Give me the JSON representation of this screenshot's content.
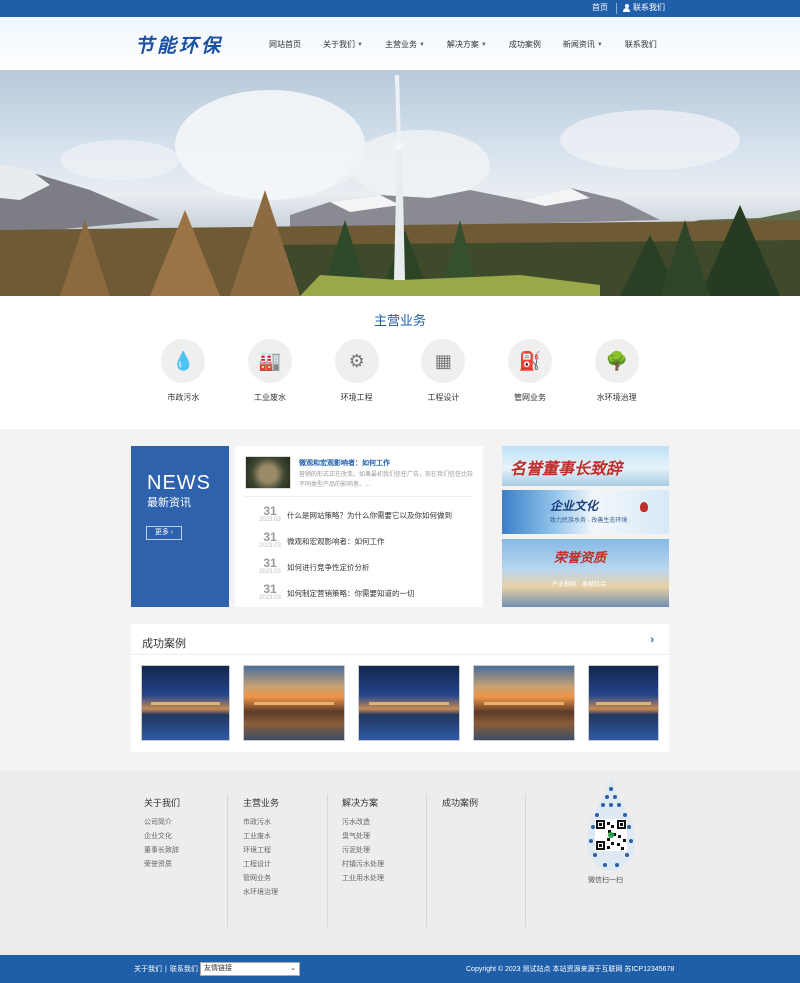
{
  "topbar": {
    "home": "首页",
    "contact": "联系我们"
  },
  "header": {
    "logo": "节能环保",
    "nav": [
      {
        "label": "网站首页"
      },
      {
        "label": "关于我们"
      },
      {
        "label": "主营业务"
      },
      {
        "label": "解决方案"
      },
      {
        "label": "成功案例"
      },
      {
        "label": "新闻资讯"
      },
      {
        "label": "联系我们"
      }
    ]
  },
  "services": {
    "title": "主营业务",
    "items": [
      {
        "label": "市政污水",
        "icon": "water-drop-icon"
      },
      {
        "label": "工业废水",
        "icon": "factory-icon"
      },
      {
        "label": "环境工程",
        "icon": "gear-icon"
      },
      {
        "label": "工程设计",
        "icon": "chart-icon"
      },
      {
        "label": "管网业务",
        "icon": "pipe-icon"
      },
      {
        "label": "水环境治理",
        "icon": "tree-icon"
      }
    ]
  },
  "news": {
    "en": "NEWS",
    "cn": "最新资讯",
    "more": "更多 ›",
    "featured": {
      "title": "微观和宏观影响者：如何工作",
      "desc": "营销的形式正在改变。如果最初我们信任广告，现在我们信任比较不同类型产品的影响者。..."
    },
    "items": [
      {
        "day": "31",
        "ym": "2023.03",
        "text": "什么是网站策略？为什么你需要它以及你如何做到"
      },
      {
        "day": "31",
        "ym": "2023.03",
        "text": "微观和宏观影响者：如何工作"
      },
      {
        "day": "31",
        "ym": "2023.03",
        "text": "如何进行竞争性定价分析"
      },
      {
        "day": "31",
        "ym": "2023.03",
        "text": "如何制定营销策略：你需要知道的一切"
      }
    ]
  },
  "promos": {
    "p1_title": "名誉董事长致辞",
    "p2_title": "企业文化",
    "p2_sub": "致力民族水务 · 改善生态环境",
    "p3_title": "荣誉资质",
    "p3_sub": "产业报国　奉献社会"
  },
  "cases": {
    "title": "成功案例",
    "arrow": "›"
  },
  "footer": {
    "columns": [
      {
        "head": "关于我们",
        "items": [
          "公司简介",
          "企业文化",
          "董事长致辞",
          "荣誉资质"
        ]
      },
      {
        "head": "主营业务",
        "items": [
          "市政污水",
          "工业废水",
          "环境工程",
          "工程设计",
          "管网业务",
          "水环境治理"
        ]
      },
      {
        "head": "解决方案",
        "items": [
          "污水改造",
          "臭气处理",
          "污泥处理",
          "村镇污水处理",
          "工业用水处理"
        ]
      },
      {
        "head": "成功案例",
        "items": []
      }
    ],
    "qr_label": "微信扫一扫"
  },
  "bottom": {
    "about": "关于我们",
    "sep": "|",
    "contact": "联系我们",
    "select": "友情链接",
    "copyright": "Copyright © 2023 测试站点 本站资源来源于互联网  苏ICP12345678"
  }
}
